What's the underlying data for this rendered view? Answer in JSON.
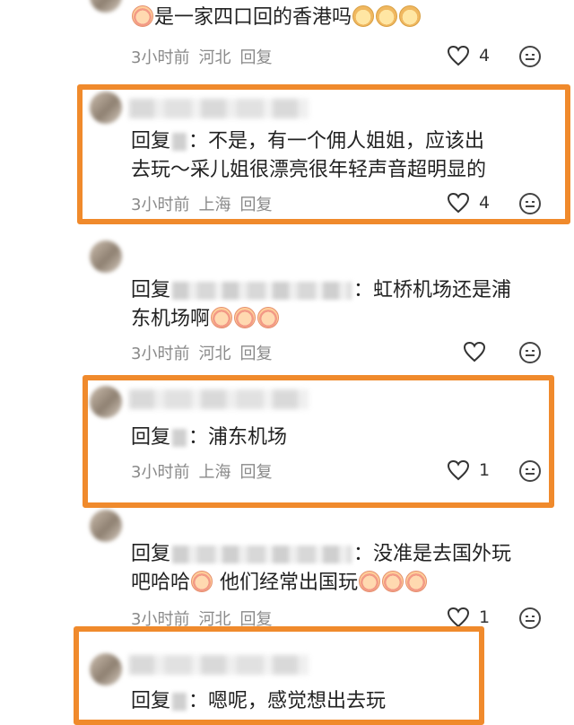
{
  "comments": [
    {
      "text": "是一家四口回的香港吗",
      "time": "3小时前",
      "location": "河北",
      "reply": "回复",
      "likes": "4"
    },
    {
      "prefix": "回复",
      "text1": "：不是，有一个佣人姐姐，应该出",
      "text2": "去玩～采儿姐很漂亮很年轻声音超明显的",
      "time": "3小时前",
      "location": "上海",
      "reply": "回复",
      "likes": "4"
    },
    {
      "prefix": "回复",
      "text1": "：虹桥机场还是浦",
      "text2": "东机场啊",
      "time": "3小时前",
      "location": "河北",
      "reply": "回复",
      "likes": ""
    },
    {
      "prefix": "回复",
      "text1": "：浦东机场",
      "time": "3小时前",
      "location": "上海",
      "reply": "回复",
      "likes": "1"
    },
    {
      "prefix": "回复",
      "text1": "：没准是去国外玩",
      "text2a": "吧哈哈",
      "text2b": "他们经常出国玩",
      "time": "3小时前",
      "location": "河北",
      "reply": "回复",
      "likes": "1"
    },
    {
      "prefix": "回复",
      "text1": "：嗯呢，感觉想出去玩"
    }
  ],
  "colors": {
    "highlight": "#f08a2c",
    "meta": "#8a8a8a"
  },
  "icons": [
    "heart-icon",
    "more-icon",
    "avatar"
  ]
}
